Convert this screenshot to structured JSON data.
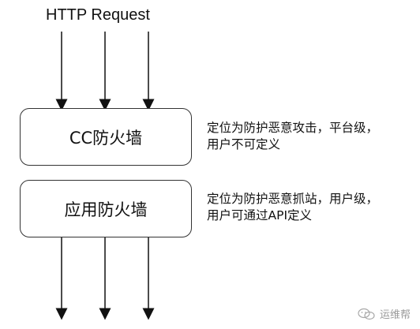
{
  "diagram": {
    "top_label": "HTTP Request",
    "boxes": [
      {
        "label": "CC防火墙",
        "description": [
          "定位为防护恶意攻击，平台级，",
          "用户不可定义"
        ]
      },
      {
        "label": "应用防火墙",
        "description": [
          "定位为防护恶意抓站，用户级，",
          "用户可通过API定义"
        ]
      }
    ]
  },
  "watermark": {
    "text": "运维帮"
  },
  "colors": {
    "stroke": "#333333",
    "text": "#111111",
    "watermark": "#9a9a9a"
  }
}
